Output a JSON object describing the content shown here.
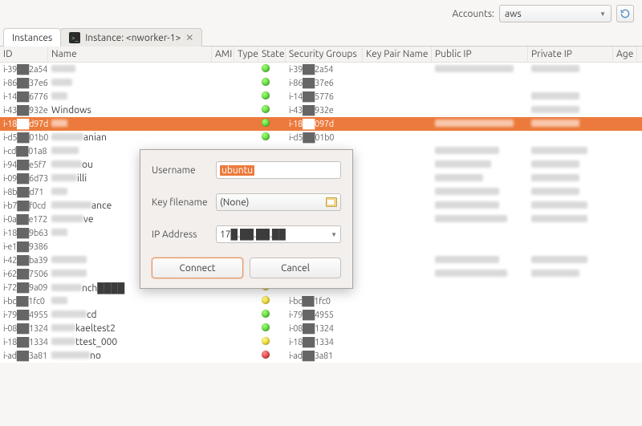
{
  "topbar": {
    "accounts_label": "Accounts:",
    "account_value": "aws"
  },
  "tabs": {
    "instances": "Instances",
    "instance_detail": "Instance: <nworker-1>"
  },
  "columns": {
    "id": "ID",
    "name": "Name",
    "ami": "AMI",
    "type": "Type",
    "state": "State",
    "sg": "Security Groups",
    "kp": "Key Pair Name",
    "pub": "Public IP",
    "priv": "Private IP",
    "age": "Age"
  },
  "rows": [
    {
      "id": "i-39██2a54",
      "name_w": 30,
      "state": "g",
      "sg": "i-39██2a54",
      "pub_w": 98,
      "priv_w": 60
    },
    {
      "id": "i-86██37e6",
      "name_w": 26,
      "state": "g",
      "sg": "i-86██37e6",
      "pub_w": 0,
      "priv_w": 0
    },
    {
      "id": "i-14██6776",
      "name_w": 20,
      "state": "g",
      "sg": "i-14██5776",
      "pub_w": 0,
      "priv_w": 60
    },
    {
      "id": "i-43██932e",
      "name_txt": "Windows",
      "state": "g",
      "sg": "i-43██932e",
      "pub_w": 0,
      "priv_w": 60
    },
    {
      "id": "i-18██d97d",
      "name_w": 20,
      "state": "g",
      "sg": "i-18██097d",
      "pub_w": 98,
      "priv_w": 60,
      "sel": true
    },
    {
      "id": "i-d5██01b0",
      "name_txt": "anian",
      "name_pre_w": 40,
      "state": "g",
      "sg": "i-d5██01b0",
      "pub_w": 0,
      "priv_w": 0
    },
    {
      "id": "i-cd██01a8",
      "name_w": 34,
      "state": "",
      "sg": "",
      "pub_w": 80,
      "priv_w": 70
    },
    {
      "id": "i-94██e5f7",
      "name_txt": "ou",
      "name_pre_w": 38,
      "state": "",
      "sg": "",
      "pub_w": 70,
      "priv_w": 60
    },
    {
      "id": "i-09██6d73",
      "name_txt": "illi",
      "name_pre_w": 32,
      "state": "",
      "sg": "",
      "pub_w": 60,
      "priv_w": 60
    },
    {
      "id": "i-8b██d71",
      "name_w": 20,
      "state": "",
      "sg": "",
      "pub_w": 80,
      "priv_w": 60
    },
    {
      "id": "i-b7██f0cd",
      "name_txt": "ance",
      "name_pre_w": 50,
      "state": "",
      "sg": "",
      "pub_w": 80,
      "priv_w": 70
    },
    {
      "id": "i-0a██e172",
      "name_txt": "ve",
      "name_pre_w": 40,
      "state": "",
      "sg": "",
      "pub_w": 90,
      "priv_w": 70
    },
    {
      "id": "i-18██9b63",
      "name_w": 20,
      "state": "",
      "sg": "",
      "pub_w": 0,
      "priv_w": 0
    },
    {
      "id": "i-e1██9386",
      "name_w": 0,
      "state": "",
      "sg": "",
      "pub_w": 0,
      "priv_w": 0
    },
    {
      "id": "i-42██ba39",
      "name_w": 44,
      "state": "",
      "sg": "",
      "pub_w": 80,
      "priv_w": 70
    },
    {
      "id": "i-62██7506",
      "name_w": 44,
      "state": "",
      "sg": "",
      "pub_w": 90,
      "priv_w": 60
    },
    {
      "id": "i-72██9a09",
      "name_txt": "nch████",
      "name_pre_w": 38,
      "state": "y",
      "sg": "",
      "pub_w": 0,
      "priv_w": 0
    },
    {
      "id": "i-bc██1fc0",
      "name_w": 20,
      "state": "y",
      "sg": "i-bc██1fc0",
      "pub_w": 0,
      "priv_w": 0
    },
    {
      "id": "i-79██4955",
      "name_txt": "cd",
      "name_pre_w": 44,
      "state": "g",
      "sg": "i-79██4955",
      "pub_w": 0,
      "priv_w": 0
    },
    {
      "id": "i-08██1324",
      "name_txt": "kaeltest2",
      "name_pre_w": 30,
      "state": "g",
      "sg": "i-08██1324",
      "pub_w": 0,
      "priv_w": 0
    },
    {
      "id": "i-18██1334",
      "name_txt": "ttest_000",
      "name_pre_w": 30,
      "state": "y",
      "sg": "i-18██1334",
      "pub_w": 0,
      "priv_w": 0
    },
    {
      "id": "i-ad██3a81",
      "name_txt": "no",
      "name_pre_w": 48,
      "state": "r",
      "sg": "i-ad██3a81",
      "pub_w": 0,
      "priv_w": 0
    }
  ],
  "dialog": {
    "username_label": "Username",
    "username_value": "ubuntu",
    "keyfile_label": "Key filename",
    "keyfile_value": "(None)",
    "ip_label": "IP Address",
    "ip_value": "17█.██.██.██",
    "connect": "Connect",
    "cancel": "Cancel"
  }
}
